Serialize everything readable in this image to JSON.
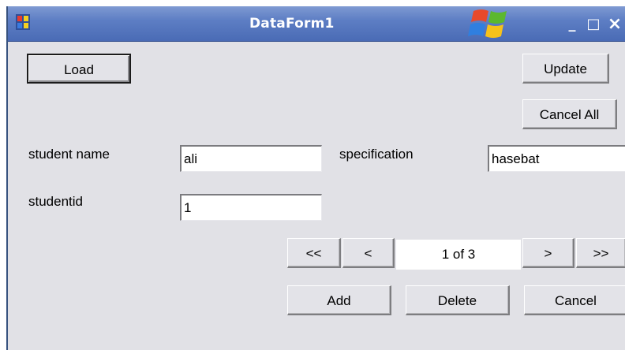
{
  "window": {
    "title": "DataForm1",
    "controls": {
      "minimize": "_",
      "maximize": "□",
      "close": "×"
    }
  },
  "toolbar": {
    "load_label": "Load",
    "update_label": "Update",
    "cancel_all_label": "Cancel All"
  },
  "form": {
    "student_name": {
      "label": "student name",
      "value": "ali"
    },
    "specification": {
      "label": "specification",
      "value": "hasebat"
    },
    "studentid": {
      "label": "studentid",
      "value": "1"
    }
  },
  "navigator": {
    "first": "<<",
    "prev": "<",
    "position": "1 of  3",
    "next": ">",
    "last": ">>"
  },
  "actions": {
    "add_label": "Add",
    "delete_label": "Delete",
    "cancel_label": "Cancel"
  },
  "colors": {
    "titlebar": "#5d7ec4",
    "form_background": "#e1e1e6"
  },
  "icons": {
    "app": "app-icon",
    "logo": "windows-xp-logo"
  }
}
